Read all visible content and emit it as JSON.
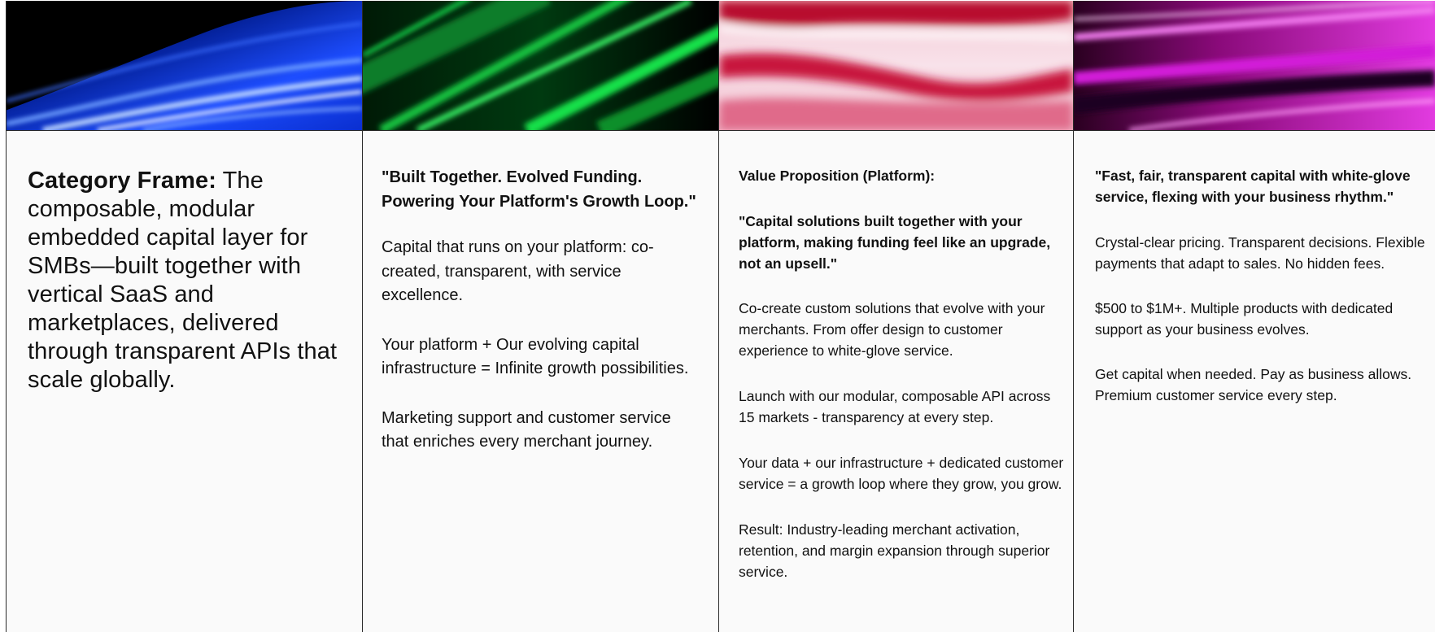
{
  "columns": [
    {
      "banner": {
        "icon": "blue-light-streaks-image",
        "accent": "#1846ff"
      },
      "label": "Category Frame:",
      "text": " The composable, modular embedded capital layer for SMBs—built together with vertical SaaS and marketplaces, delivered through transparent APIs that scale globally."
    },
    {
      "banner": {
        "icon": "green-light-streaks-image",
        "accent": "#19e04a"
      },
      "headline": "\"Built Together. Evolved Funding. Powering Your Platform's Growth Loop.\"",
      "paragraphs": [
        "Capital that runs on your platform: co-created, transparent, with service excellence.",
        "Your platform + Our evolving capital infrastructure = Infinite growth possibilities.",
        "Marketing support and customer service that enriches every merchant journey."
      ]
    },
    {
      "banner": {
        "icon": "red-light-waves-image",
        "accent": "#c0123a"
      },
      "label": "Value Proposition (Platform):",
      "headline": "\"Capital solutions built together with your platform, making funding feel like an upgrade, not an upsell.\"",
      "paragraphs": [
        "Co-create custom solutions that evolve with your merchants. From offer design to customer experience to white-glove service.",
        "Launch with our modular, composable API across 15 markets - transparency at every step.",
        "Your data + our infrastructure + dedicated customer service = a growth loop where they grow, you grow.",
        "Result: Industry-leading merchant activation, retention, and margin expansion through superior service."
      ]
    },
    {
      "banner": {
        "icon": "magenta-light-streaks-image",
        "accent": "#d21ad8"
      },
      "headline": "\"Fast, fair, transparent capital with white-glove service, flexing with your business rhythm.\"",
      "paragraphs": [
        "Crystal-clear pricing. Transparent decisions. Flexible payments that adapt to sales. No hidden fees.",
        "$500 to $1M+. Multiple products with dedicated support as your business evolves.",
        "Get capital when needed. Pay as business allows. Premium customer service every step."
      ]
    }
  ]
}
